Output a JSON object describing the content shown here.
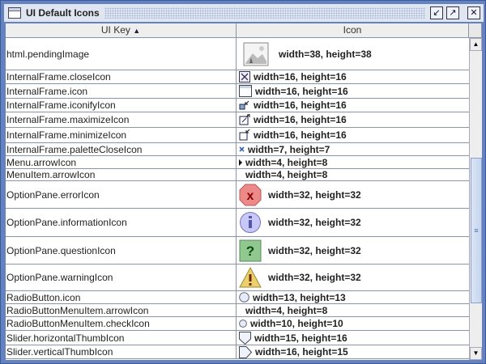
{
  "window": {
    "title": "UI Default Icons",
    "buttons": {
      "iconify": "iconify",
      "maximize": "maximize",
      "close": "close"
    }
  },
  "table": {
    "columns": [
      "UI Key",
      "Icon"
    ],
    "sort_indicator": "▲",
    "rows": [
      {
        "key": "html.pendingImage",
        "value": "width=38, height=38",
        "icon": "image-icon"
      },
      {
        "key": "InternalFrame.closeIcon",
        "value": "width=16, height=16",
        "icon": "close-icon"
      },
      {
        "key": "InternalFrame.icon",
        "value": "width=16, height=16",
        "icon": "frame-icon"
      },
      {
        "key": "InternalFrame.iconifyIcon",
        "value": "width=16, height=16",
        "icon": "iconify-icon"
      },
      {
        "key": "InternalFrame.maximizeIcon",
        "value": "width=16, height=16",
        "icon": "maximize-icon"
      },
      {
        "key": "InternalFrame.minimizeIcon",
        "value": "width=16, height=16",
        "icon": "minimize-icon"
      },
      {
        "key": "InternalFrame.paletteCloseIcon",
        "value": "width=7, height=7",
        "icon": "small-x-icon"
      },
      {
        "key": "Menu.arrowIcon",
        "value": "width=4, height=8",
        "icon": "arrow-right-icon"
      },
      {
        "key": "MenuItem.arrowIcon",
        "value": "width=4, height=8",
        "icon": "blank-icon"
      },
      {
        "key": "OptionPane.errorIcon",
        "value": "width=32, height=32",
        "icon": "error-icon"
      },
      {
        "key": "OptionPane.informationIcon",
        "value": "width=32, height=32",
        "icon": "information-icon"
      },
      {
        "key": "OptionPane.questionIcon",
        "value": "width=32, height=32",
        "icon": "question-icon"
      },
      {
        "key": "OptionPane.warningIcon",
        "value": "width=32, height=32",
        "icon": "warning-icon"
      },
      {
        "key": "RadioButton.icon",
        "value": "width=13, height=13",
        "icon": "radio-icon"
      },
      {
        "key": "RadioButtonMenuItem.arrowIcon",
        "value": "width=4, height=8",
        "icon": "blank-icon"
      },
      {
        "key": "RadioButtonMenuItem.checkIcon",
        "value": "width=10, height=10",
        "icon": "radio-small-icon"
      },
      {
        "key": "Slider.horizontalThumbIcon",
        "value": "width=15, height=16",
        "icon": "slider-horizontal-thumb-icon"
      },
      {
        "key": "Slider.verticalThumbIcon",
        "value": "width=16, height=15",
        "icon": "slider-vertical-thumb-icon"
      }
    ]
  }
}
